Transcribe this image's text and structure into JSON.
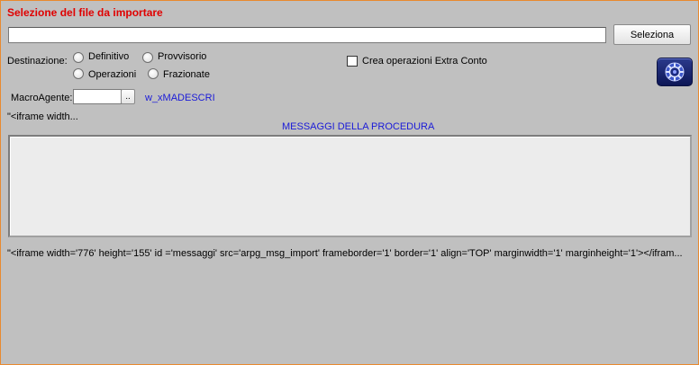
{
  "header": {
    "title": "Selezione del file da importare"
  },
  "file": {
    "value": "",
    "button_label": "Seleziona"
  },
  "destination": {
    "label": "Destinazione:",
    "options": [
      "Definitivo",
      "Provvisorio",
      "Operazioni",
      "Frazionate"
    ]
  },
  "extra": {
    "checkbox_label": "Crea operazioni Extra Conto",
    "checked": false
  },
  "macro": {
    "label": "MacroAgente:",
    "value": "",
    "browse_label": "..",
    "descr_field": "w_xMADESCRI"
  },
  "iframe_snippet_short": "\"<iframe width...",
  "messages": {
    "title": "MESSAGGI DELLA PROCEDURA"
  },
  "iframe_snippet_long": "\"<iframe width='776' height='155' id ='messaggi' src='arpg_msg_import' frameborder='1'  border='1' align='TOP' marginwidth='1' marginheight='1'></ifram...",
  "icons": {
    "action_button": "gear-icon"
  },
  "colors": {
    "title_red": "#e00000",
    "link_blue": "#1a1ad8",
    "background": "#c0c0c0",
    "border_orange": "#e8892f"
  }
}
